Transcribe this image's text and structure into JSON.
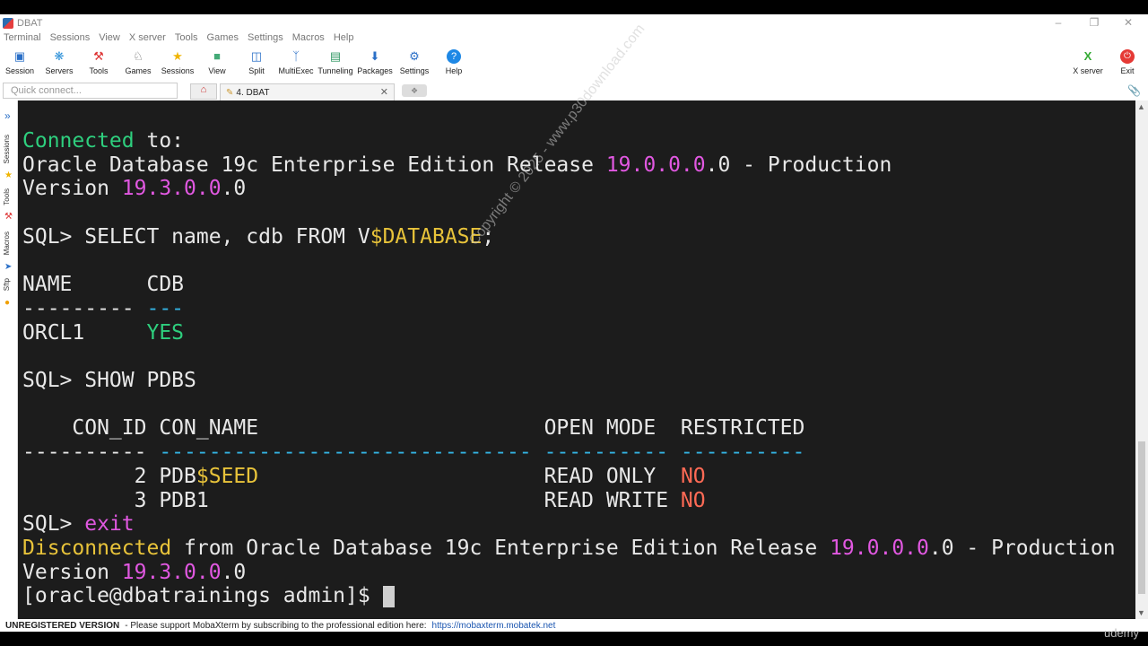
{
  "app": {
    "title": "DBAT"
  },
  "menu": [
    "Terminal",
    "Sessions",
    "View",
    "X server",
    "Tools",
    "Games",
    "Settings",
    "Macros",
    "Help"
  ],
  "toolbar": [
    {
      "label": "Session",
      "icon": "session-icon"
    },
    {
      "label": "Servers",
      "icon": "servers-icon"
    },
    {
      "label": "Tools",
      "icon": "tools-icon"
    },
    {
      "label": "Games",
      "icon": "games-icon"
    },
    {
      "label": "Sessions",
      "icon": "star-icon"
    },
    {
      "label": "View",
      "icon": "view-icon"
    },
    {
      "label": "Split",
      "icon": "split-icon"
    },
    {
      "label": "MultiExec",
      "icon": "multiexec-icon"
    },
    {
      "label": "Tunneling",
      "icon": "tunneling-icon"
    },
    {
      "label": "Packages",
      "icon": "packages-icon"
    },
    {
      "label": "Settings",
      "icon": "gear-icon"
    },
    {
      "label": "Help",
      "icon": "help-icon"
    }
  ],
  "toolbar_right": {
    "xserver": "X server",
    "exit": "Exit"
  },
  "quick_connect": {
    "placeholder": "Quick connect..."
  },
  "tab": {
    "label": "4. DBAT"
  },
  "sidebar": [
    "Sessions",
    "Tools",
    "Macros",
    "Sftp"
  ],
  "terminal_lines": [
    "<span class=\"g\">Connected</span> to:",
    "Oracle Database 19c Enterprise Edition Release <span class=\"m\">19.0.0.0</span>.0 - Production",
    "Version <span class=\"m\">19.3.0.0</span>.0",
    "",
    "SQL> SELECT name, cdb FROM V<span class=\"y\">$DATABASE</span>;",
    "",
    "NAME      CDB",
    "--------- <span class=\"c\">---</span>",
    "ORCL1     <span class=\"g\">YES</span>",
    "",
    "SQL> SHOW PDBS",
    "",
    "    CON_ID CON_NAME                       OPEN MODE  RESTRICTED",
    "---------- <span class=\"c\">------------------------------ ---------- ----------</span>",
    "         2 PDB<span class=\"y\">$SEED</span>                       READ ONLY  <span class=\"r\">NO</span>",
    "         3 PDB1                           READ WRITE <span class=\"r\">NO</span>",
    "SQL> <span class=\"m\">exit</span>",
    "<span class=\"y\">Disconnected</span> from Oracle Database 19c Enterprise Edition Release <span class=\"m\">19.0.0.0</span>.0 - Production",
    "Version <span class=\"m\">19.3.0.0</span>.0",
    "[oracle@dbatrainings admin]$ <span class=\"cursor\"></span>"
  ],
  "watermark": "Copyright © 2025 - www.p30download.com",
  "status": {
    "unregistered": "UNREGISTERED VERSION",
    "message": "-  Please support MobaXterm by subscribing to the professional edition here:",
    "link": "https://mobaxterm.mobatek.net"
  },
  "overlay": {
    "brand": "udemy"
  },
  "colors": {
    "terminal_bg": "#1c1c1c",
    "green": "#2ecf7e",
    "magenta": "#e158e1",
    "yellow": "#e8c33a",
    "cyan": "#33b5e5",
    "red": "#ff6a55"
  }
}
